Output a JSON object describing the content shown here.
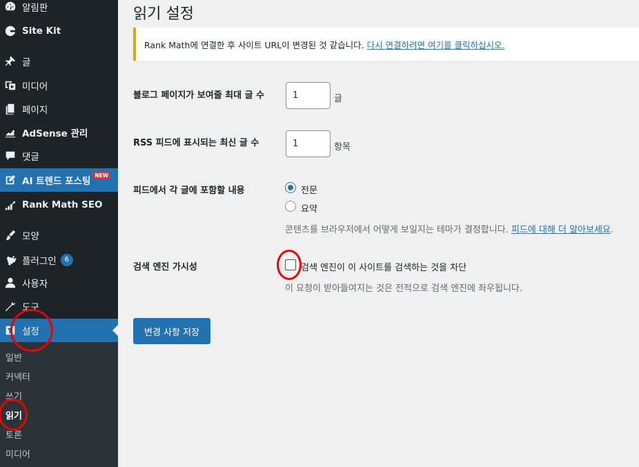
{
  "sidebar": {
    "items": [
      {
        "label": "알림판",
        "icon": "dashboard-icon"
      },
      {
        "label": "Site Kit",
        "icon": "site-kit-icon"
      },
      {
        "label": "글",
        "icon": "pin-icon"
      },
      {
        "label": "미디어",
        "icon": "media-icon"
      },
      {
        "label": "페이지",
        "icon": "pages-icon"
      },
      {
        "label": "AdSense 관리",
        "icon": "chart-icon"
      },
      {
        "label": "댓글",
        "icon": "comment-icon"
      },
      {
        "label": "AI 트렌드 포스팅",
        "icon": "edit-icon",
        "badge": "NEW"
      },
      {
        "label": "Rank Math SEO",
        "icon": "rank-math-icon"
      },
      {
        "label": "모양",
        "icon": "brush-icon"
      },
      {
        "label": "플러그인",
        "icon": "plugin-icon",
        "count": "6"
      },
      {
        "label": "사용자",
        "icon": "user-icon"
      },
      {
        "label": "도구",
        "icon": "wrench-icon"
      },
      {
        "label": "설정",
        "icon": "settings-icon"
      }
    ],
    "submenu": [
      "일반",
      "커넥터",
      "쓰기",
      "읽기",
      "토론",
      "미디어"
    ]
  },
  "page": {
    "title": "읽기 설정",
    "notice_text": "Rank Math에 연결한 후 사이트 URL이 변경된 것 같습니다.",
    "notice_link": "다시 연결하려면 여기를 클릭하십시오.",
    "posts_per_page_label": "블로그 페이지가 보여줄 최대 글 수",
    "posts_per_page_value": "1",
    "posts_per_page_unit": "글",
    "rss_label": "RSS 피드에 표시되는 최신 글 수",
    "rss_value": "1",
    "rss_unit": "항목",
    "feed_content_label": "피드에서 각 글에 포함할 내용",
    "feed_option_full": "전문",
    "feed_option_excerpt": "요약",
    "feed_desc": "콘텐츠를 브라우저에서 어떻게 보일지는 테마가 결정합니다.",
    "feed_desc_link": "피드에 대해 더 알아보세요",
    "feed_desc_end": ".",
    "search_label": "검색 엔진 가시성",
    "search_checkbox_label": "검색 엔진이 이 사이트를 검색하는 것을 차단",
    "search_desc": "이 요청이 받아들여지는 것은 전적으로 검색 엔진에 좌우됩니다.",
    "save_button": "변경 사항 저장"
  },
  "colors": {
    "sidebar_bg": "#1d2327",
    "accent": "#2271b1",
    "notice_border": "#dba617",
    "annotation": "#e00000"
  }
}
